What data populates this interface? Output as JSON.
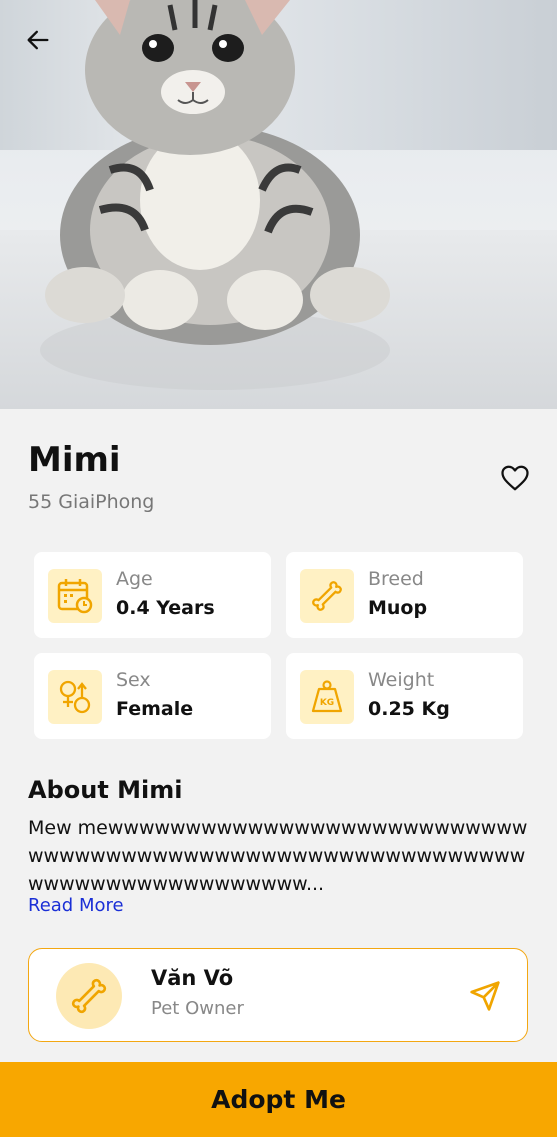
{
  "pet": {
    "name": "Mimi",
    "address": "55 GiaiPhong"
  },
  "stats": [
    {
      "label": "Age",
      "value": "0.4 Years",
      "icon": "calendar-icon"
    },
    {
      "label": "Breed",
      "value": "Muop",
      "icon": "bone-icon"
    },
    {
      "label": "Sex",
      "value": "Female",
      "icon": "gender-icon"
    },
    {
      "label": "Weight",
      "value": "0.25 Kg",
      "icon": "weight-icon"
    }
  ],
  "about": {
    "title": "About Mimi",
    "text": "Mew mewwwwwwwwwwwwwwwwwwwwwwwwwwwwwwwwwwwwwwwwwwwwwwwwwwwwwwwwwwwwwwwwwwwwwwwwwwwww...",
    "read_more": "Read More"
  },
  "owner": {
    "name": "Văn Võ",
    "role": "Pet Owner",
    "avatar_icon": "bone-icon"
  },
  "actions": {
    "adopt_label": "Adopt Me"
  },
  "colors": {
    "accent": "#f8a700",
    "icon_bg": "#fff1c4",
    "icon_stroke": "#f0a500",
    "link": "#1a2fd6"
  }
}
